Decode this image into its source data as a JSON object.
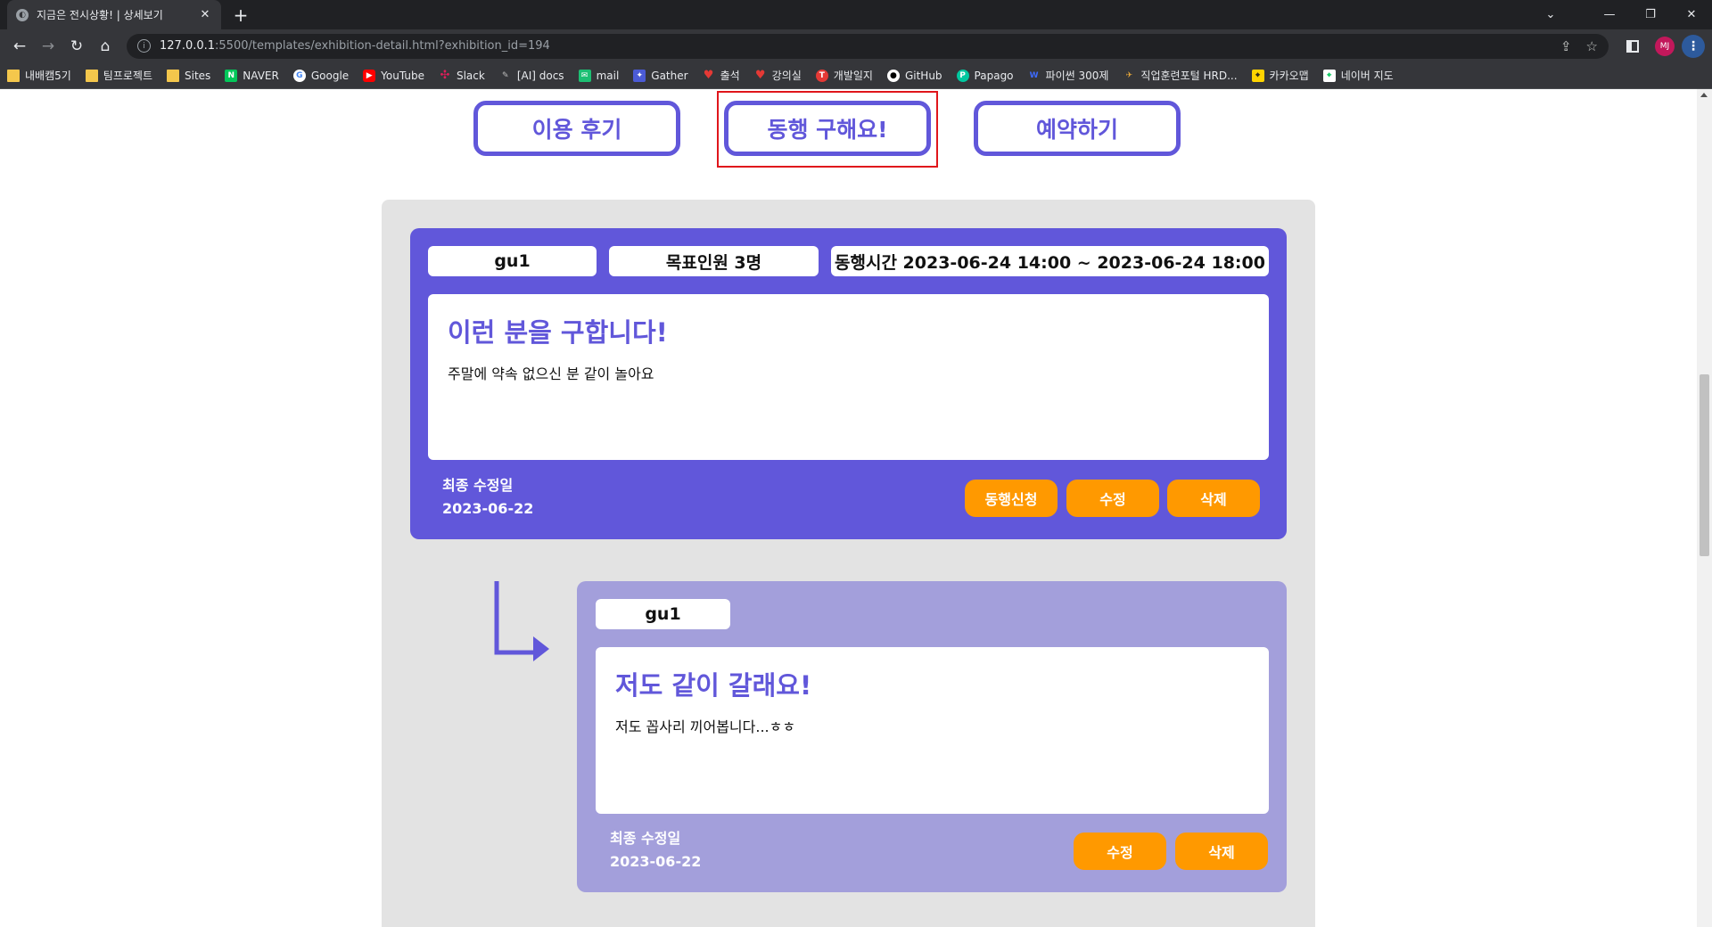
{
  "browser": {
    "tab_title": "지금은 전시상황! | 상세보기",
    "url_host": "127.0.0.1",
    "url_path": ":5500/templates/exhibition-detail.html?exhibition_id=194",
    "profile_initials": "MJ",
    "bookmarks": [
      {
        "label": "내배캠5기",
        "icon": "folder-icon"
      },
      {
        "label": "팀프로젝트",
        "icon": "folder-icon"
      },
      {
        "label": "Sites",
        "icon": "folder-icon"
      },
      {
        "label": "NAVER",
        "icon": "naver-icon"
      },
      {
        "label": "Google",
        "icon": "google-icon"
      },
      {
        "label": "YouTube",
        "icon": "youtube-icon"
      },
      {
        "label": "Slack",
        "icon": "slack-icon"
      },
      {
        "label": "[AI] docs",
        "icon": "ai-docs-icon"
      },
      {
        "label": "mail",
        "icon": "mail-icon"
      },
      {
        "label": "Gather",
        "icon": "gather-icon"
      },
      {
        "label": "출석",
        "icon": "heart-icon"
      },
      {
        "label": "강의실",
        "icon": "heart-icon"
      },
      {
        "label": "개발일지",
        "icon": "blog-icon"
      },
      {
        "label": "GitHub",
        "icon": "github-icon"
      },
      {
        "label": "Papago",
        "icon": "papago-icon"
      },
      {
        "label": "파이썬 300제",
        "icon": "wikidocs-icon"
      },
      {
        "label": "직업훈련포털 HRD...",
        "icon": "hrd-icon"
      },
      {
        "label": "카카오맵",
        "icon": "kakaomap-icon"
      },
      {
        "label": "네이버 지도",
        "icon": "navermap-icon"
      }
    ]
  },
  "page": {
    "tabs": [
      {
        "label": "이용 후기"
      },
      {
        "label": "동행 구해요!"
      },
      {
        "label": "예약하기"
      }
    ],
    "post": {
      "author": "gu1",
      "target": "목표인원 3명",
      "time": "동행시간 2023-06-24 14:00 ~ 2023-06-24 18:00",
      "title": "이런 분을 구합니다!",
      "body": "주말에 약속 없으신 분 같이 놀아요",
      "updated_label": "최종 수정일",
      "updated_date": "2023-06-22",
      "buttons": {
        "apply": "동행신청",
        "edit": "수정",
        "delete": "삭제"
      }
    },
    "reply": {
      "author": "gu1",
      "title": "저도 같이 갈래요!",
      "body": "저도 꼽사리 끼어봅니다...ㅎㅎ",
      "updated_label": "최종 수정일",
      "updated_date": "2023-06-22",
      "buttons": {
        "edit": "수정",
        "delete": "삭제"
      }
    }
  },
  "colors": {
    "accent": "#6157da",
    "reply_bg": "#a39fdb",
    "button": "#ff9900",
    "highlight": "#e0161b"
  }
}
